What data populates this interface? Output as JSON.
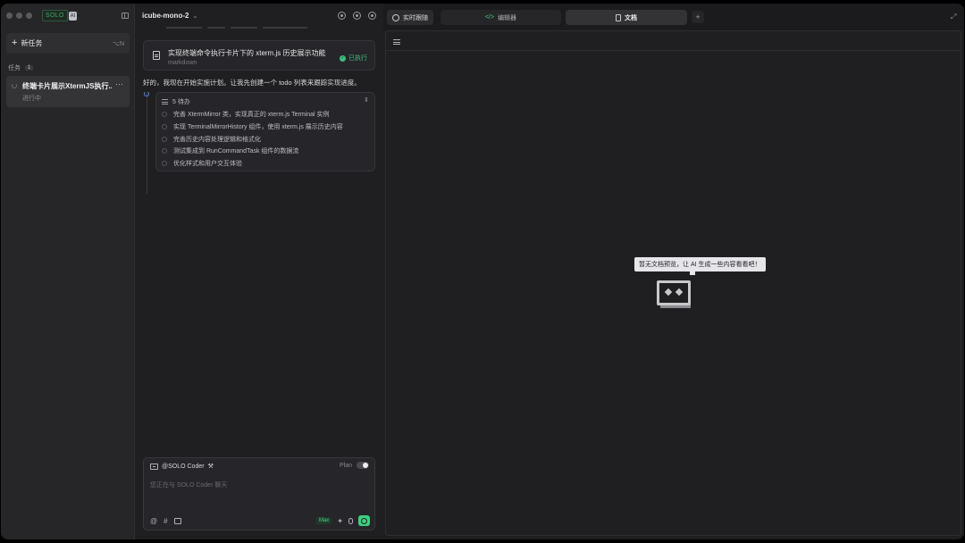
{
  "sidebar": {
    "logo_text": "SOLO",
    "logo_badge": "AI",
    "new_task_label": "新任务",
    "new_task_shortcut": "⌥N",
    "tasks_label": "任务",
    "tasks_count": "1",
    "task": {
      "title": "终端卡片展示XtermJS执行...",
      "status": "进行中",
      "more": "···"
    }
  },
  "chat": {
    "project": "icube-mono-2",
    "file_card": {
      "name": "实现终端命令执行卡片下的 xterm.js 历史展示功能",
      "type": "markdown",
      "status": "已执行"
    },
    "message": "好的，我现在开始实施计划。让我先创建一个 todo 列表来跟踪实现进度。",
    "todo": {
      "header": "5 待办",
      "items": [
        "完善 XtermMirror 类，实现真正的 xterm.js Terminal 实例",
        "实现 TerminalMirrorHistory 组件，使用 xterm.js 展示历史内容",
        "完善历史内容处理逻辑和格式化",
        "测试集成到 RunCommandTask 组件的数据流",
        "优化样式和用户交互体验"
      ]
    },
    "composer": {
      "agent": "@SOLO Coder",
      "plan_label": "Plan",
      "placeholder": "您正在与 SOLO Coder 聊天",
      "max_label": "Max"
    }
  },
  "right": {
    "tabs": {
      "live": "实时跟随",
      "editor": "编辑器",
      "docs": "文档"
    },
    "add_tab": "+",
    "empty_message": "暂无文档预览，让 AI 生成一些内容看看吧！"
  },
  "icons": [
    "plus-icon",
    "panel-toggle-icon",
    "document-icon",
    "check-icon",
    "list-icon",
    "bot-icon",
    "at-icon",
    "hash-icon",
    "image-icon",
    "sparkle-icon",
    "mic-icon",
    "send-icon",
    "code-icon",
    "live-icon",
    "expand-icon",
    "toc-icon",
    "robot-icon"
  ],
  "colors": {
    "accent_green": "#3fcf7f",
    "background": "#1f1f21",
    "sidebar": "#262628"
  }
}
